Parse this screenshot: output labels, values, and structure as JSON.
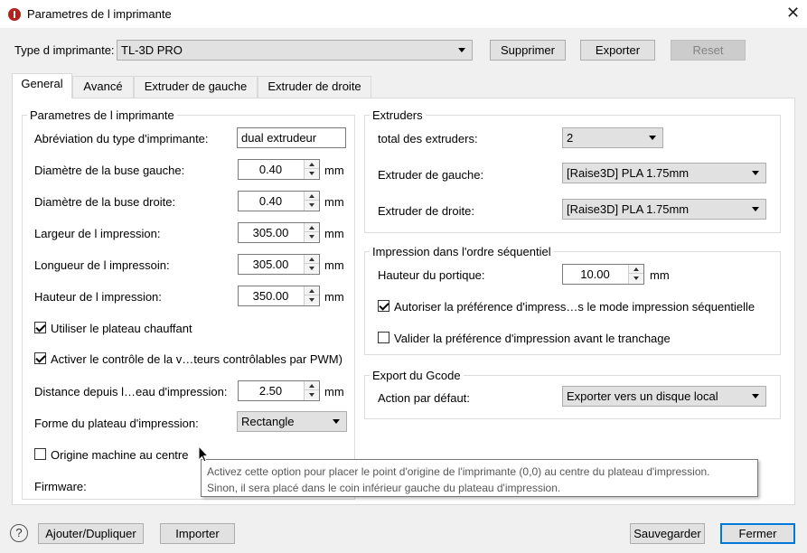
{
  "window": {
    "title": "Parametres de l imprimante"
  },
  "top": {
    "printer_type_label": "Type d imprimante:",
    "printer_type_value": "TL-3D PRO",
    "delete_label": "Supprimer",
    "export_label": "Exporter",
    "reset_label": "Reset"
  },
  "tabs": [
    {
      "label": "General"
    },
    {
      "label": "Avancé"
    },
    {
      "label": "Extruder de gauche"
    },
    {
      "label": "Extruder de droite"
    }
  ],
  "printer": {
    "group_title": "Parametres de l imprimante",
    "abbr_label": "Abréviation du type d'imprimante:",
    "abbr_value": "dual extrudeur",
    "nozzle_left_label": "Diamètre de la buse gauche:",
    "nozzle_left_value": "0.40",
    "nozzle_right_label": "Diamètre de la buse droite:",
    "nozzle_right_value": "0.40",
    "width_label": "Largeur de l impression:",
    "width_value": "305.00",
    "length_label": "Longueur de l impressoin:",
    "length_value": "305.00",
    "height_label": "Hauteur de l impression:",
    "height_value": "350.00",
    "unit": "mm",
    "heated_bed_label": "Utiliser le plateau chauffant",
    "pwm_label": "Activer le contrôle de la v…teurs contrôlables par PWM)",
    "distance_label": "Distance depuis l…eau d'impression:",
    "distance_value": "2.50",
    "bed_shape_label": "Forme du plateau d'impression:",
    "bed_shape_value": "Rectangle",
    "origin_center_label": "Origine machine au centre",
    "firmware_label": "Firmware:"
  },
  "extruders": {
    "group_title": "Extruders",
    "total_label": "total des extruders:",
    "total_value": "2",
    "left_label": "Extruder de gauche:",
    "left_value": "[Raise3D] PLA 1.75mm",
    "right_label": "Extruder de droite:",
    "right_value": "[Raise3D] PLA 1.75mm"
  },
  "sequential": {
    "group_title": "Impression dans l'ordre séquentiel",
    "gantry_label": "Hauteur du portique:",
    "gantry_value": "10.00",
    "unit": "mm",
    "allow_label": "Autoriser la préférence d'impress…s le mode impression séquentielle",
    "validate_label": "Valider la préférence d'impression avant le tranchage"
  },
  "gcode": {
    "group_title": "Export du Gcode",
    "action_label": "Action par défaut:",
    "action_value": "Exporter vers un disque local"
  },
  "tooltip": {
    "line1": "Activez cette option pour placer le point d'origine de l'imprimante (0,0) au centre du plateau d'impression.",
    "line2": "Sinon, il sera placé dans le coin inférieur gauche du plateau d'impression."
  },
  "footer": {
    "help": "?",
    "add_duplicate_label": "Ajouter/Dupliquer",
    "import_label": "Importer",
    "save_label": "Sauvegarder",
    "close_label": "Fermer"
  }
}
